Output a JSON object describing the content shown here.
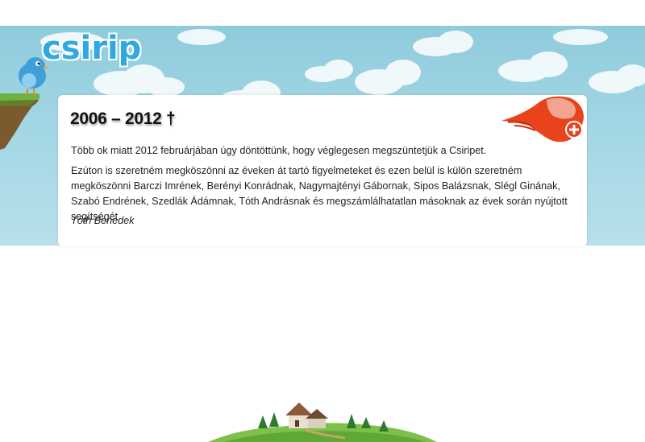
{
  "brand": {
    "logo_text": "csirip"
  },
  "notice": {
    "title": "2006 – 2012 †",
    "paragraph1": "Több ok miatt 2012 februárjában úgy döntöttünk, hogy véglegesen megszüntetjük a Csiripet.",
    "paragraph2": "Ezúton is szeretném megköszönni az éveken át tartó figyelmeteket és ezen belül is külön szeretném megköszönni Barczi Imrének, Berényi Konrádnak, Nagymajtényi Gábornak, Sipos Balázsnak, Slégl Ginának, Szabó Endrének, Szedlák Ádámnak, Tóth Andrásnak és megszámlálhatatlan másoknak az évek során nyújtott segítségét.",
    "signature": "Tóth Benedek"
  },
  "icons": {
    "mascot": "bird-mascot-icon",
    "badge": "red-bird-plus-badge-icon",
    "footer": "village-island-illustration"
  },
  "colors": {
    "sky_top": "#8fcbdc",
    "sky_bottom": "#b7e0ea",
    "logo_blue": "#2fa9df",
    "badge_red": "#e8431c",
    "card_bg": "#ffffff"
  }
}
